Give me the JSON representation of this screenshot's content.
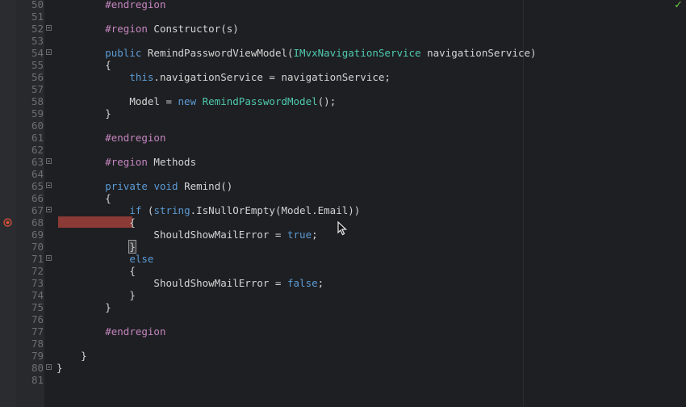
{
  "editor": {
    "status_icon": "checkmark-icon",
    "status_color": "#6ecb3f",
    "breakpoint_color": "#8c3a36",
    "breakpoint_line": 68,
    "lines": [
      {
        "n": "50",
        "fold": false,
        "indent": "        ",
        "tokens": [
          {
            "t": "#endregion",
            "c": "pp"
          }
        ]
      },
      {
        "n": "51",
        "fold": false,
        "indent": "",
        "tokens": []
      },
      {
        "n": "52",
        "fold": true,
        "indent": "        ",
        "tokens": [
          {
            "t": "#region",
            "c": "pp"
          },
          {
            "t": " Constructor(s)",
            "c": "tx"
          }
        ]
      },
      {
        "n": "53",
        "fold": false,
        "indent": "",
        "tokens": []
      },
      {
        "n": "54",
        "fold": true,
        "indent": "        ",
        "tokens": [
          {
            "t": "public",
            "c": "kw"
          },
          {
            "t": " RemindPasswordViewModel(",
            "c": "tx"
          },
          {
            "t": "IMvxNavigationService",
            "c": "ty"
          },
          {
            "t": " navigationService)",
            "c": "tx"
          }
        ]
      },
      {
        "n": "55",
        "fold": false,
        "indent": "        ",
        "tokens": [
          {
            "t": "{",
            "c": "tx"
          }
        ]
      },
      {
        "n": "56",
        "fold": false,
        "indent": "            ",
        "tokens": [
          {
            "t": "this",
            "c": "kw"
          },
          {
            "t": ".navigationService = navigationService;",
            "c": "tx"
          }
        ]
      },
      {
        "n": "57",
        "fold": false,
        "indent": "",
        "tokens": []
      },
      {
        "n": "58",
        "fold": false,
        "indent": "            ",
        "tokens": [
          {
            "t": "Model = ",
            "c": "tx"
          },
          {
            "t": "new",
            "c": "kw"
          },
          {
            "t": " ",
            "c": "tx"
          },
          {
            "t": "RemindPasswordModel",
            "c": "ty"
          },
          {
            "t": "();",
            "c": "tx"
          }
        ]
      },
      {
        "n": "59",
        "fold": false,
        "indent": "        ",
        "tokens": [
          {
            "t": "}",
            "c": "tx"
          }
        ]
      },
      {
        "n": "60",
        "fold": false,
        "indent": "",
        "tokens": []
      },
      {
        "n": "61",
        "fold": false,
        "indent": "        ",
        "tokens": [
          {
            "t": "#endregion",
            "c": "pp"
          }
        ]
      },
      {
        "n": "62",
        "fold": false,
        "indent": "",
        "tokens": []
      },
      {
        "n": "63",
        "fold": true,
        "indent": "        ",
        "tokens": [
          {
            "t": "#region",
            "c": "pp"
          },
          {
            "t": " Methods",
            "c": "tx"
          }
        ]
      },
      {
        "n": "64",
        "fold": false,
        "indent": "",
        "tokens": []
      },
      {
        "n": "65",
        "fold": true,
        "indent": "        ",
        "tokens": [
          {
            "t": "private",
            "c": "kw"
          },
          {
            "t": " ",
            "c": "tx"
          },
          {
            "t": "void",
            "c": "kw"
          },
          {
            "t": " Remind()",
            "c": "tx"
          }
        ]
      },
      {
        "n": "66",
        "fold": false,
        "indent": "        ",
        "tokens": [
          {
            "t": "{",
            "c": "tx"
          }
        ]
      },
      {
        "n": "67",
        "fold": true,
        "indent": "            ",
        "tokens": [
          {
            "t": "if",
            "c": "kw"
          },
          {
            "t": " (",
            "c": "tx"
          },
          {
            "t": "string",
            "c": "kw"
          },
          {
            "t": ".IsNullOrEmpty(Model.Email))",
            "c": "tx"
          }
        ]
      },
      {
        "n": "68",
        "fold": false,
        "indent": "            ",
        "tokens": [
          {
            "t": "{",
            "c": "tx"
          }
        ]
      },
      {
        "n": "69",
        "fold": false,
        "indent": "                ",
        "tokens": [
          {
            "t": "ShouldShowMailError = ",
            "c": "tx"
          },
          {
            "t": "true",
            "c": "kw"
          },
          {
            "t": ";",
            "c": "tx"
          }
        ]
      },
      {
        "n": "70",
        "fold": false,
        "indent": "            ",
        "tokens": [
          {
            "t": "}",
            "c": "tx",
            "hl": true
          }
        ]
      },
      {
        "n": "71",
        "fold": true,
        "indent": "            ",
        "tokens": [
          {
            "t": "else",
            "c": "kw"
          }
        ]
      },
      {
        "n": "72",
        "fold": false,
        "indent": "            ",
        "tokens": [
          {
            "t": "{",
            "c": "tx"
          }
        ]
      },
      {
        "n": "73",
        "fold": false,
        "indent": "                ",
        "tokens": [
          {
            "t": "ShouldShowMailError = ",
            "c": "tx"
          },
          {
            "t": "false",
            "c": "kw"
          },
          {
            "t": ";",
            "c": "tx"
          }
        ]
      },
      {
        "n": "74",
        "fold": false,
        "indent": "            ",
        "tokens": [
          {
            "t": "}",
            "c": "tx"
          }
        ]
      },
      {
        "n": "75",
        "fold": false,
        "indent": "        ",
        "tokens": [
          {
            "t": "}",
            "c": "tx"
          }
        ]
      },
      {
        "n": "76",
        "fold": false,
        "indent": "",
        "tokens": []
      },
      {
        "n": "77",
        "fold": false,
        "indent": "        ",
        "tokens": [
          {
            "t": "#endregion",
            "c": "pp"
          }
        ]
      },
      {
        "n": "78",
        "fold": false,
        "indent": "",
        "tokens": []
      },
      {
        "n": "79",
        "fold": false,
        "indent": "    ",
        "tokens": [
          {
            "t": "}",
            "c": "tx"
          }
        ]
      },
      {
        "n": "80",
        "fold": true,
        "indent": "",
        "tokens": [
          {
            "t": "}",
            "c": "tx"
          }
        ]
      },
      {
        "n": "81",
        "fold": false,
        "indent": "",
        "tokens": []
      }
    ]
  }
}
